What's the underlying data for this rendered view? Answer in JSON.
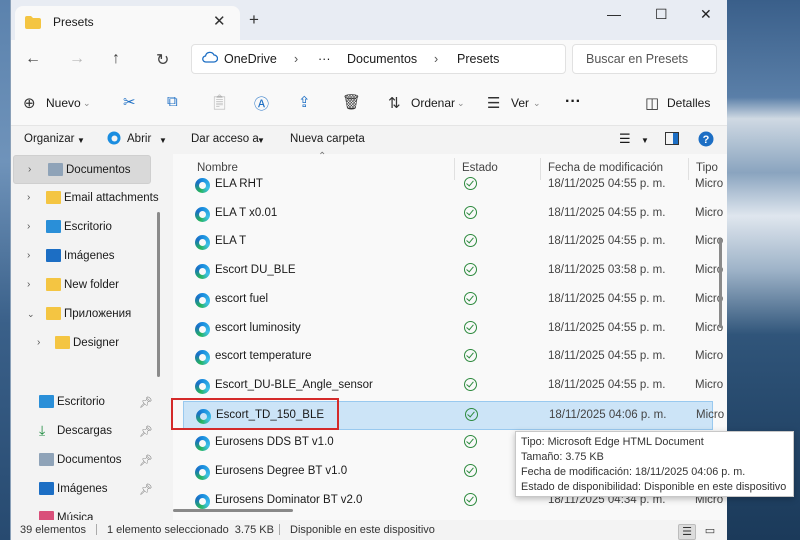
{
  "window": {
    "tab_title": "Presets",
    "minimize": "—",
    "maximize": "☐",
    "close": "✕"
  },
  "address": {
    "breadcrumb": [
      "OneDrive",
      "Documentos",
      "Presets"
    ],
    "ellipsis": "···",
    "search_placeholder": "Buscar en Presets"
  },
  "commands": {
    "new": "Nuevo",
    "sort": "Ordenar",
    "view": "Ver",
    "more": "···",
    "details": "Detalles"
  },
  "toolbar2": {
    "organize": "Organizar",
    "open": "Abrir",
    "share": "Dar acceso a",
    "new_folder": "Nueva carpeta"
  },
  "sidebar": {
    "tree": [
      {
        "label": "Documentos",
        "selected": true
      },
      {
        "label": "Email attachments"
      },
      {
        "label": "Escritorio"
      },
      {
        "label": "Imágenes"
      },
      {
        "label": "New folder"
      },
      {
        "label": "Приложения"
      },
      {
        "label": "Designer"
      }
    ],
    "quick": [
      {
        "label": "Escritorio"
      },
      {
        "label": "Descargas"
      },
      {
        "label": "Documentos"
      },
      {
        "label": "Imágenes"
      },
      {
        "label": "Música"
      }
    ]
  },
  "columns": {
    "name": "Nombre",
    "status": "Estado",
    "date": "Fecha de modificación",
    "type": "Tipo"
  },
  "files": [
    {
      "name": "ELA RHT",
      "date": "18/11/2025 04:55 p. m.",
      "type": "Micro"
    },
    {
      "name": "ELA T x0.01",
      "date": "18/11/2025 04:55 p. m.",
      "type": "Micro"
    },
    {
      "name": "ELA T",
      "date": "18/11/2025 04:55 p. m.",
      "type": "Micro"
    },
    {
      "name": "Escort DU_BLE",
      "date": "18/11/2025 03:58 p. m.",
      "type": "Micro"
    },
    {
      "name": "escort fuel",
      "date": "18/11/2025 04:55 p. m.",
      "type": "Micro"
    },
    {
      "name": "escort luminosity",
      "date": "18/11/2025 04:55 p. m.",
      "type": "Micro"
    },
    {
      "name": "escort temperature",
      "date": "18/11/2025 04:55 p. m.",
      "type": "Micro"
    },
    {
      "name": "Escort_DU-BLE_Angle_sensor",
      "date": "18/11/2025 04:55 p. m.",
      "type": "Micro"
    },
    {
      "name": "Escort_TD_150_BLE",
      "date": "18/11/2025 04:06 p. m.",
      "type": "Micro",
      "selected": true
    },
    {
      "name": "Eurosens DDS BT v1.0",
      "date": "",
      "type": ""
    },
    {
      "name": "Eurosens Degree BT v1.0",
      "date": "",
      "type": ""
    },
    {
      "name": "Eurosens Dominator BT v2.0",
      "date": "18/11/2025 04:34 p. m.",
      "type": "Micro"
    }
  ],
  "tooltip": {
    "type": "Tipo: Microsoft Edge HTML Document",
    "size": "Tamaño: 3.75 KB",
    "modified": "Fecha de modificación: 18/11/2025 04:06 p. m.",
    "availability": "Estado de disponibilidad: Disponible en este dispositivo"
  },
  "statusbar": {
    "count": "39 elementos",
    "selection": "1 elemento seleccionado  3.75 KB",
    "availability": "Disponible en este dispositivo"
  }
}
